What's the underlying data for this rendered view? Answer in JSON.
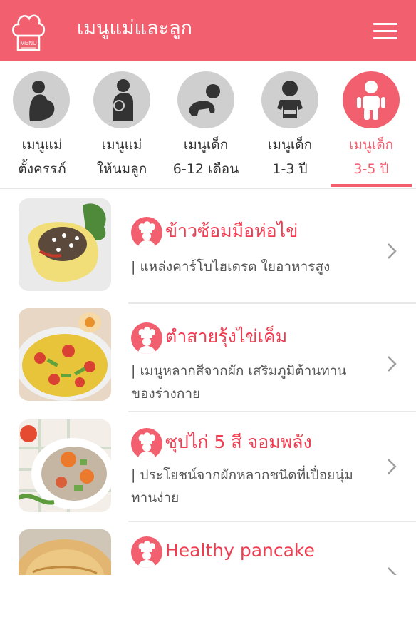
{
  "app": {
    "title": "เมนูแม่และลูก",
    "logo_icon": "chef-hat-logo-icon",
    "logo_text": "MENU",
    "menu_icon": "hamburger-menu-icon",
    "accent_color": "#f25f6e",
    "title_color": "#f03c50"
  },
  "tabs": [
    {
      "line1": "เมนูแม่",
      "line2": "ตั้งครรภ์",
      "icon": "pregnant-mother-icon",
      "active": false
    },
    {
      "line1": "เมนูแม่",
      "line2": "ให้นมลูก",
      "icon": "breastfeeding-mother-icon",
      "active": false
    },
    {
      "line1": "เมนูเด็ก",
      "line2": "6-12 เดือน",
      "icon": "crawling-baby-icon",
      "active": false
    },
    {
      "line1": "เมนูเด็ก",
      "line2": "1-3 ปี",
      "icon": "toddler-icon",
      "active": false
    },
    {
      "line1": "เมนูเด็ก",
      "line2": "3-5 ปี",
      "icon": "child-icon",
      "active": true
    }
  ],
  "recipes": [
    {
      "title": "ข้าวซ้อมมือห่อไข่",
      "desc": "| แหล่งคาร์โบไฮเดรต ใยอาหารสูง",
      "thumb": "rice-omelette-photo",
      "icon": "chef-icon"
    },
    {
      "title": "ตำสายรุ้งไข่เค็ม",
      "desc": "| เมนูหลากสีจากผัก เสริมภูมิต้านทานของร่างกาย",
      "thumb": "rainbow-salad-photo",
      "icon": "chef-icon"
    },
    {
      "title": "ซุปไก่ 5 สี จอมพลัง",
      "desc": "| ประโยชน์จากผักหลากชนิดที่เปื่อยนุ่ม ทานง่าย",
      "thumb": "chicken-soup-photo",
      "icon": "chef-icon"
    },
    {
      "title": "Healthy pancake",
      "desc": "",
      "thumb": "pancake-photo",
      "icon": "chef-icon"
    }
  ]
}
